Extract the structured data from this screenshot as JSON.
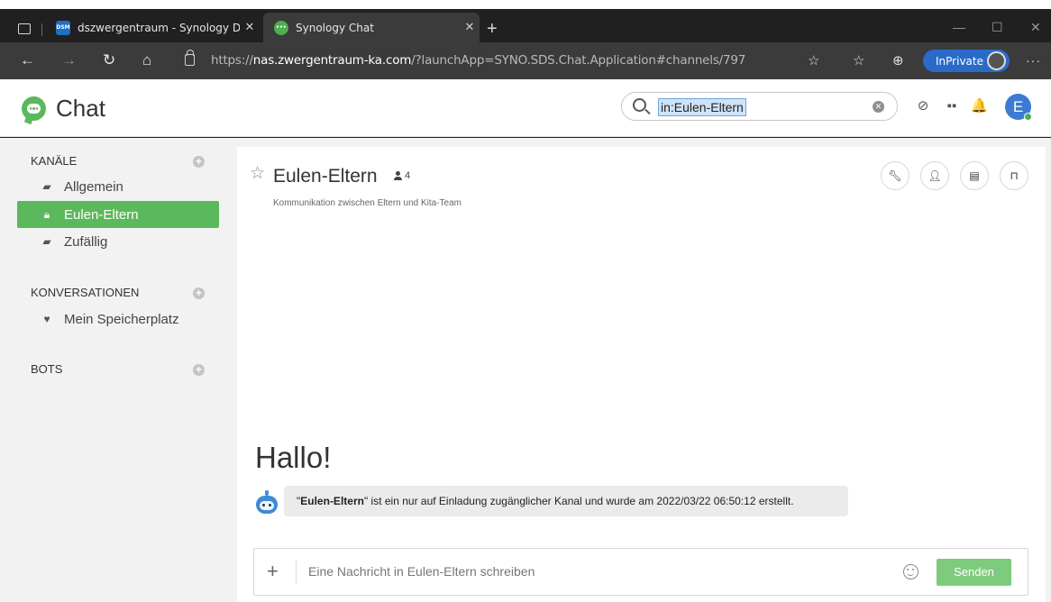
{
  "browser": {
    "tabs": [
      {
        "label": "dszwergentraum - Synology Disk",
        "favicon": "DSM",
        "active": false
      },
      {
        "label": "Synology Chat",
        "favicon": "chat-icon",
        "active": true
      }
    ],
    "url_prefix": "https://",
    "url_host": "nas.zwergentraum-ka.com",
    "url_path": "/?launchApp=SYNO.SDS.Chat.Application#channels/797",
    "inprivate_label": "InPrivate"
  },
  "app": {
    "logo_text": "Chat",
    "search_value": "in:Eulen-Eltern",
    "avatar_letter": "E",
    "accent_color": "#5cb85c"
  },
  "sidebar": {
    "channels_title": "KANÄLE",
    "channels": [
      {
        "label": "Allgemein",
        "icon": "chat-bubble-icon",
        "active": false
      },
      {
        "label": "Eulen-Eltern",
        "icon": "lock-icon",
        "active": true
      },
      {
        "label": "Zufällig",
        "icon": "chat-bubble-icon",
        "active": false
      }
    ],
    "conversations_title": "KONVERSATIONEN",
    "conversations": [
      {
        "label": "Mein Speicherplatz",
        "icon": "heart-icon"
      }
    ],
    "bots_title": "BOTS"
  },
  "channel": {
    "name": "Eulen-Eltern",
    "member_count": "4",
    "description": "Kommunikation zwischen Eltern und Kita-Team",
    "welcome": "Hallo!",
    "system_message_pre": "\"",
    "system_message_name": "Eulen-Eltern",
    "system_message_post": "\" ist ein nur auf Einladung zugänglicher Kanal und wurde am 2022/03/22 06:50:12 erstellt."
  },
  "composer": {
    "placeholder": "Eine Nachricht in Eulen-Eltern schreiben",
    "send_label": "Senden"
  }
}
